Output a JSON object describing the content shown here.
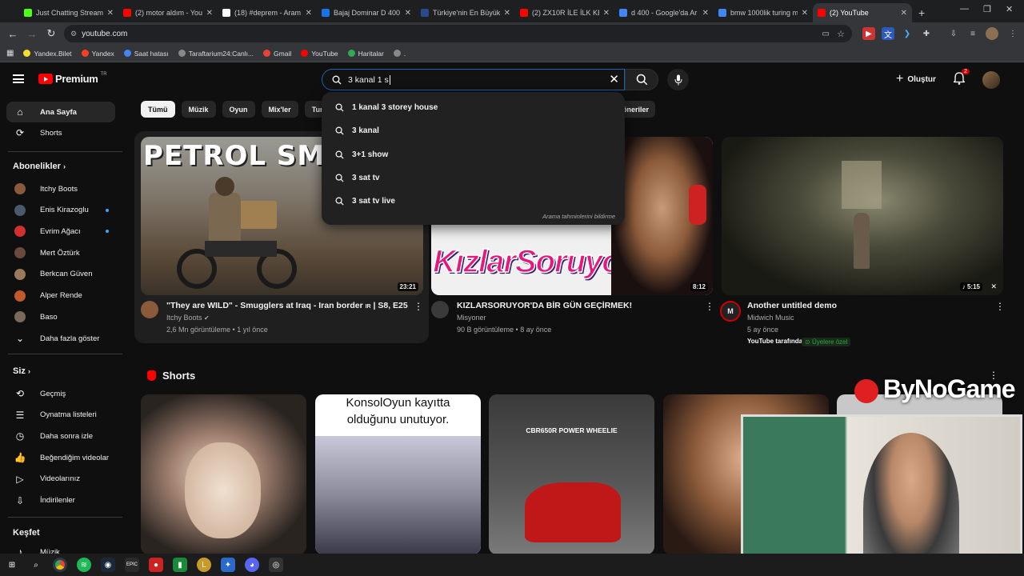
{
  "browser": {
    "tabs": [
      {
        "title": "Just Chatting Stream",
        "color": "#53fc18"
      },
      {
        "title": "(2) motor aldım - You",
        "color": "#ff0000"
      },
      {
        "title": "(18) #deprem - Aram",
        "color": "#ffffff"
      },
      {
        "title": "Bajaj Dominar D 400",
        "color": "#1a73e8"
      },
      {
        "title": "Türkiye'nin En Büyük",
        "color": "#2a4a8a"
      },
      {
        "title": "(2) ZX10R İLE İLK KEZ",
        "color": "#ff0000"
      },
      {
        "title": "d 400 - Google'da Ar",
        "color": "#4285f4"
      },
      {
        "title": "bmw 1000lik turing m",
        "color": "#4285f4"
      },
      {
        "title": "(2) YouTube",
        "color": "#ff0000"
      }
    ],
    "url": "youtube.com",
    "bookmarks": [
      {
        "label": "Yandex.Bilet",
        "color": "#fcdc2a"
      },
      {
        "label": "Yandex",
        "color": "#fc3f1d"
      },
      {
        "label": "Saat hatası",
        "color": "#4285f4"
      },
      {
        "label": "Taraftarium24:Canlı...",
        "color": "#888888"
      },
      {
        "label": "Gmail",
        "color": "#ea4335"
      },
      {
        "label": "YouTube",
        "color": "#ff0000"
      },
      {
        "label": "Haritalar",
        "color": "#34a853"
      },
      {
        "label": ".",
        "color": "#888888"
      }
    ]
  },
  "youtube": {
    "logo": "Premium",
    "logo_country": "TR",
    "search_value": "3 kanal 1 s",
    "create_label": "Oluştur",
    "notif_count": "2",
    "suggestions": [
      "1 kanal 3 storey house",
      "3 kanal",
      "3+1 show",
      "3 sat tv",
      "3 sat tv live"
    ],
    "report_label": "Arama tahminlerini bildirme",
    "chips": [
      "Tümü",
      "Müzik",
      "Oyun",
      "Mix'ler",
      "Turizm"
    ],
    "chip_right": "öneriler",
    "sidebar": {
      "home": "Ana Sayfa",
      "shorts": "Shorts",
      "subs_header": "Abonelikler",
      "subs": [
        {
          "name": "Itchy Boots",
          "color": "#8a5a3a",
          "dot": false
        },
        {
          "name": "Enis Kirazoglu",
          "color": "#4a5a6a",
          "dot": true
        },
        {
          "name": "Evrim Ağacı",
          "color": "#d03030",
          "dot": true
        },
        {
          "name": "Mert Öztürk",
          "color": "#6a4a3a",
          "dot": false
        },
        {
          "name": "Berkcan Güven",
          "color": "#9a7a5a",
          "dot": false
        },
        {
          "name": "Alper Rende",
          "color": "#c05a2a",
          "dot": false
        },
        {
          "name": "Baso",
          "color": "#7a6a5a",
          "dot": false
        }
      ],
      "more": "Daha fazla göster",
      "you_header": "Siz",
      "you_items": [
        "Geçmiş",
        "Oynatma listeleri",
        "Daha sonra izle",
        "Beğendiğim videolar",
        "Videolarınız",
        "İndirilenler"
      ],
      "explore_header": "Keşfet",
      "explore_items": [
        "Müzik"
      ]
    },
    "videos": [
      {
        "title": "\"They are WILD\" - Smugglers at Iraq - Iran border",
        "title_suffix": "| S8, E25",
        "channel": "Itchy Boots",
        "meta": "2,6 Mn görüntüleme • 1 yıl önce",
        "duration": "23:21",
        "thumb_text": "PETROL SMUG"
      },
      {
        "title": "KIZLARSORUYOR'DA BİR GÜN GEÇİRMEK!",
        "channel": "Misyoner",
        "meta": "90 B görüntüleme • 8 ay önce",
        "duration": "8:12",
        "thumb_text": "KızlarSoruyor"
      },
      {
        "title": "Another untitled demo",
        "channel": "Midwich Music",
        "meta": "5 ay önce",
        "duration": "5:15",
        "promo": "YouTube tarafından öne...",
        "member": "Üyelere özel",
        "avatar_text": "M"
      }
    ],
    "shorts_header": "Shorts",
    "shorts": [
      {
        "text": ""
      },
      {
        "text": "KonsolOyun kayıtta olduğunu unutuyor."
      },
      {
        "text": "CBR650R POWER WHEELIE"
      },
      {
        "text": ""
      }
    ]
  },
  "overlay": {
    "brand": "ByNoGame"
  }
}
